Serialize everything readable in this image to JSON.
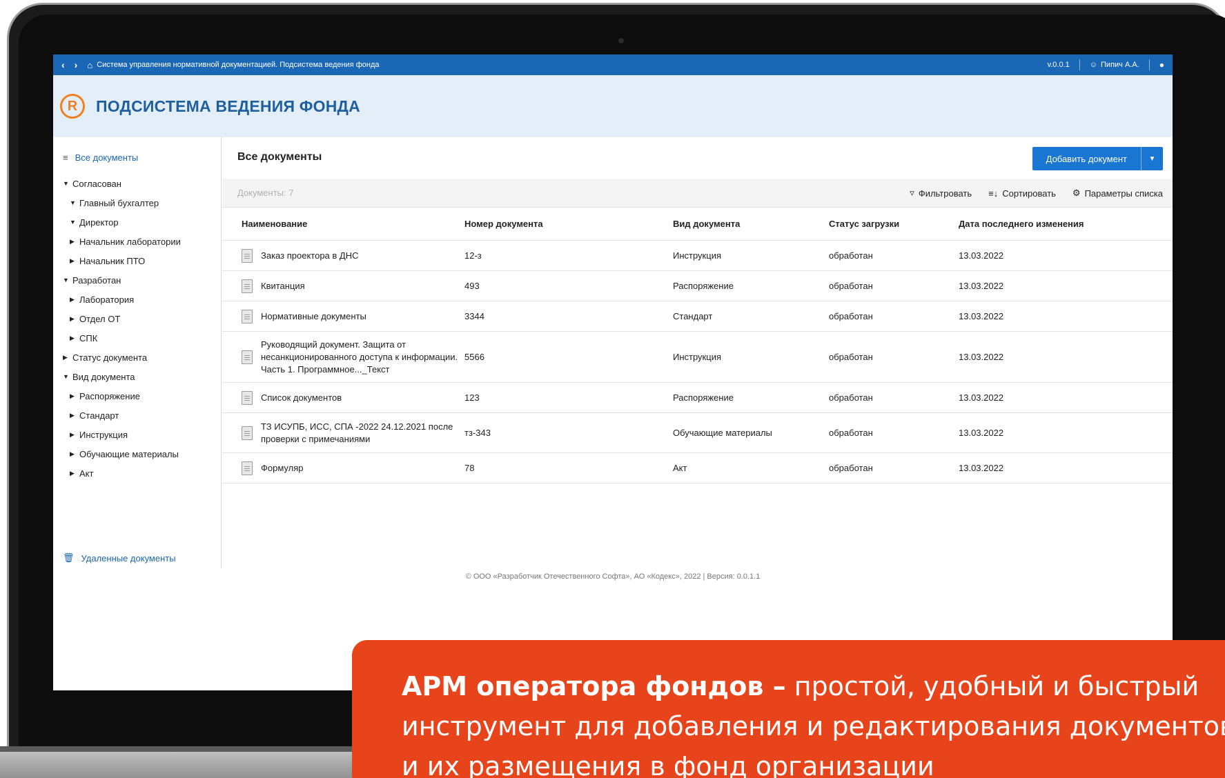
{
  "topbar": {
    "back_icon": "chevron-left",
    "forward_icon": "chevron-right",
    "home_icon": "home",
    "system_title": "Система управления нормативной документацией. Подсистема ведения фонда",
    "version": "v.0.0.1",
    "user": "Пипич А.А.",
    "help_icon": "chat-help"
  },
  "header": {
    "logo_letter": "R",
    "title": "ПОДСИСТЕМА ВЕДЕНИЯ ФОНДА"
  },
  "sidebar": {
    "all_docs": "Все документы",
    "tree": [
      {
        "label": "Согласован",
        "level": 0,
        "expanded": true
      },
      {
        "label": "Главный бухгалтер",
        "level": 1,
        "expanded": true
      },
      {
        "label": "Директор",
        "level": 1,
        "expanded": true
      },
      {
        "label": "Начальник лаборатории",
        "level": 1,
        "expanded": false
      },
      {
        "label": "Начальник ПТО",
        "level": 1,
        "expanded": false
      },
      {
        "label": "Разработан",
        "level": 0,
        "expanded": true
      },
      {
        "label": "Лаборатория",
        "level": 1,
        "expanded": false
      },
      {
        "label": "Отдел ОТ",
        "level": 1,
        "expanded": false
      },
      {
        "label": "СПК",
        "level": 1,
        "expanded": false
      },
      {
        "label": "Статус документа",
        "level": 0,
        "expanded": false
      },
      {
        "label": "Вид документа",
        "level": 0,
        "expanded": true
      },
      {
        "label": "Распоряжение",
        "level": 1,
        "expanded": false
      },
      {
        "label": "Стандарт",
        "level": 1,
        "expanded": false
      },
      {
        "label": "Инструкция",
        "level": 1,
        "expanded": false
      },
      {
        "label": "Обучающие материалы",
        "level": 1,
        "expanded": false
      },
      {
        "label": "Акт",
        "level": 1,
        "expanded": false
      }
    ],
    "deleted_docs": "Удаленные документы"
  },
  "main": {
    "title": "Все документы",
    "add_button": "Добавить документ",
    "count": "Документы: 7",
    "filter": "Фильтровать",
    "sort": "Сортировать",
    "list_params": "Параметры списка",
    "columns": [
      "Наименование",
      "Номер документа",
      "Вид документа",
      "Статус загрузки",
      "Дата последнего изменения"
    ],
    "rows": [
      {
        "name": "Заказ проектора в ДНС",
        "number": "12-з",
        "type": "Инструкция",
        "status": "обработан",
        "date": "13.03.2022"
      },
      {
        "name": "Квитанция",
        "number": "493",
        "type": "Распоряжение",
        "status": "обработан",
        "date": "13.03.2022"
      },
      {
        "name": "Нормативные документы",
        "number": "3344",
        "type": "Стандарт",
        "status": "обработан",
        "date": "13.03.2022"
      },
      {
        "name": "Руководящий документ. Защита от несанкционированного доступа к информации. Часть 1. Программное..._Текст",
        "number": "5566",
        "type": "Инструкция",
        "status": "обработан",
        "date": "13.03.2022"
      },
      {
        "name": "Список документов",
        "number": "123",
        "type": "Распоряжение",
        "status": "обработан",
        "date": "13.03.2022"
      },
      {
        "name": "ТЗ ИСУПБ, ИСС, СПА -2022 24.12.2021 после проверки с примечаниями",
        "number": "тз-343",
        "type": "Обучающие материалы",
        "status": "обработан",
        "date": "13.03.2022"
      },
      {
        "name": "Формуляр",
        "number": "78",
        "type": "Акт",
        "status": "обработан",
        "date": "13.03.2022"
      }
    ]
  },
  "footer": "© ООО «Разработчик Отечественного Софта», АО «Кодекс», 2022 | Версия: 0.0.1.1",
  "banner": {
    "bold": "АРМ оператора фондов –",
    "line1_rest": " простой, удобный и быстрый",
    "line2": "инструмент для добавления и редактирования документов",
    "line3": "и их размещения в фонд организации"
  },
  "colors": {
    "accent": "#1a67b5",
    "button": "#1976d2",
    "header_bg": "#e3eef8",
    "logo": "#f0801f",
    "banner": "#e8441b"
  }
}
